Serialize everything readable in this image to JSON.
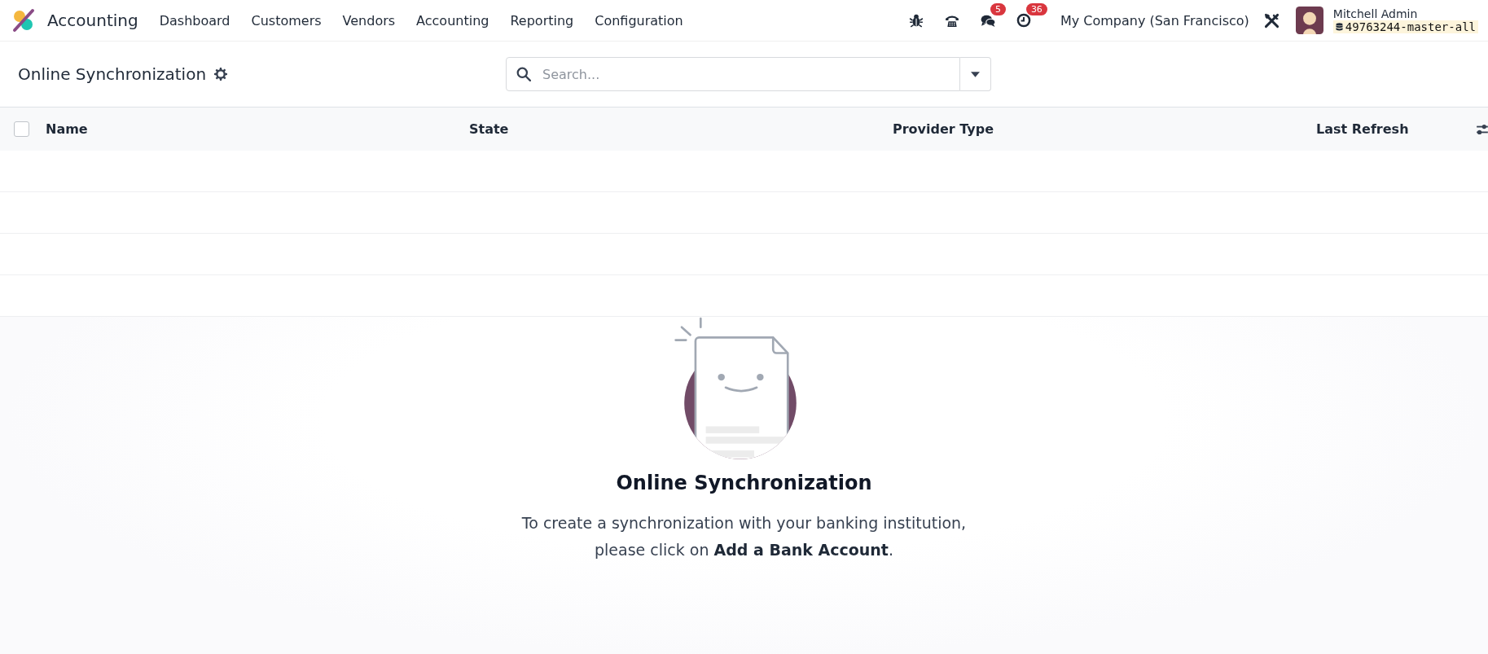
{
  "navbar": {
    "app_name": "Accounting",
    "menu": [
      "Dashboard",
      "Customers",
      "Vendors",
      "Accounting",
      "Reporting",
      "Configuration"
    ],
    "systray": [
      {
        "kind": "bug"
      },
      {
        "kind": "phone"
      },
      {
        "kind": "chat",
        "badge": "5"
      },
      {
        "kind": "clock",
        "badge": "36"
      }
    ],
    "company": "My Company (San Francisco)",
    "user_name": "Mitchell Admin",
    "database": "49763244-master-all"
  },
  "control_panel": {
    "breadcrumb": "Online Synchronization",
    "search": {
      "placeholder": "Search..."
    }
  },
  "table": {
    "select_all": {
      "checked": false
    },
    "columns": [
      "Name",
      "State",
      "Provider Type",
      "Last Refresh"
    ]
  },
  "empty_state": {
    "title": "Online Synchronization",
    "message": [
      "To create a synchronization with your banking institution,",
      "please click on **Add a Bank Account**."
    ]
  }
}
